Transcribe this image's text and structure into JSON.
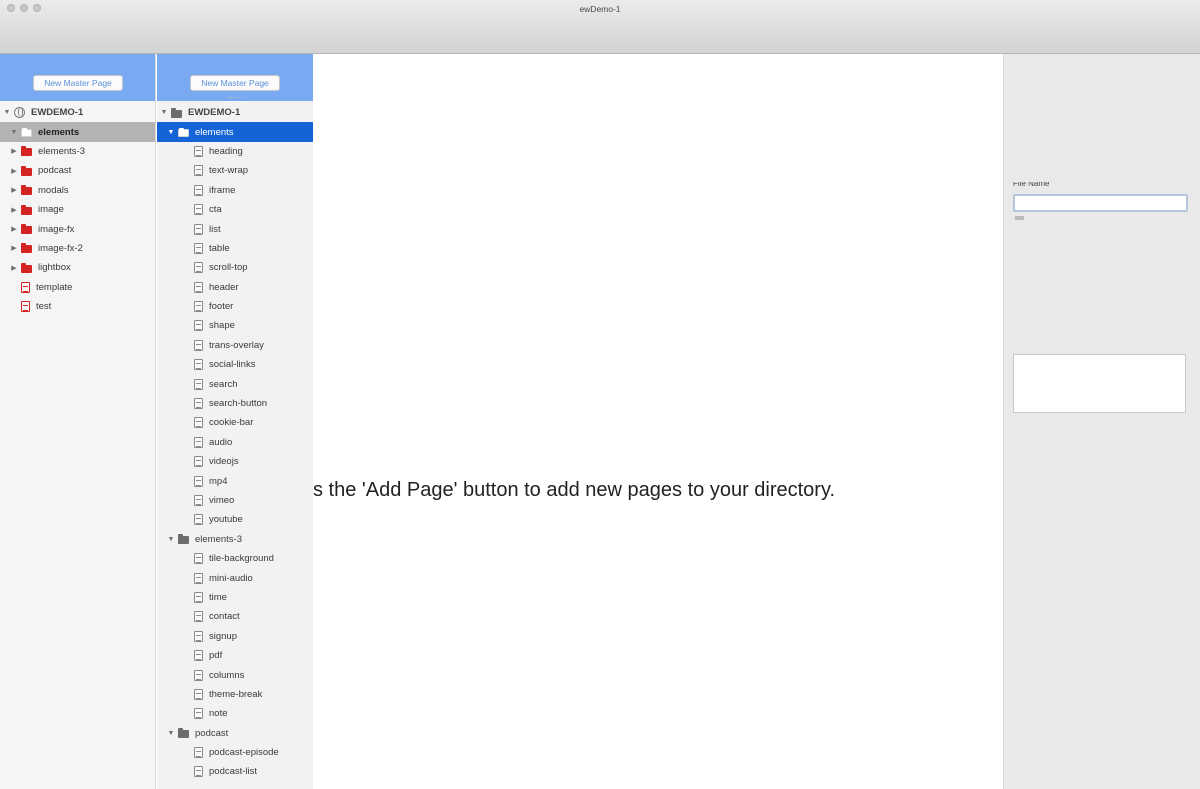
{
  "window": {
    "title": "ewDemo-1"
  },
  "left_panel": {
    "button_label": "New Master Page",
    "root_label": "EWDEMO-1",
    "items": [
      {
        "label": "elements",
        "kind": "folder",
        "state": "selected",
        "icon": "folder-open-icon"
      },
      {
        "label": "elements-3",
        "kind": "folder",
        "icon": "folder-icon"
      },
      {
        "label": "podcast",
        "kind": "folder",
        "icon": "folder-icon"
      },
      {
        "label": "modals",
        "kind": "folder",
        "icon": "folder-icon"
      },
      {
        "label": "image",
        "kind": "folder",
        "icon": "folder-icon"
      },
      {
        "label": "image-fx",
        "kind": "folder",
        "icon": "folder-icon"
      },
      {
        "label": "image-fx-2",
        "kind": "folder",
        "icon": "folder-icon"
      },
      {
        "label": "lightbox",
        "kind": "folder",
        "icon": "folder-icon"
      },
      {
        "label": "template",
        "kind": "page",
        "icon": "page-icon"
      },
      {
        "label": "test",
        "kind": "page",
        "icon": "page-icon"
      }
    ]
  },
  "mid_panel": {
    "button_label": "New Master Page",
    "root_label": "EWDEMO-1",
    "groups": [
      {
        "label": "elements",
        "state": "selected",
        "pages": [
          "heading",
          "text-wrap",
          "iframe",
          "cta",
          "list",
          "table",
          "scroll-top",
          "header",
          "footer",
          "shape",
          "trans-overlay",
          "social-links",
          "search",
          "search-button",
          "cookie-bar",
          "audio",
          "videojs",
          "mp4",
          "vimeo",
          "youtube"
        ]
      },
      {
        "label": "elements-3",
        "pages": [
          "tile-background",
          "mini-audio",
          "time",
          "contact",
          "signup",
          "pdf",
          "columns",
          "theme-break",
          "note"
        ]
      },
      {
        "label": "podcast",
        "pages": [
          "podcast-episode",
          "podcast-list"
        ]
      }
    ]
  },
  "main": {
    "hint": "s the 'Add Page' button to add new pages to your directory."
  },
  "inspector": {
    "file_name_label": "File Name",
    "file_name_value": ""
  },
  "colors": {
    "panel_header": "#79a9f1",
    "selection_blue": "#1464d8",
    "selection_grey": "#b3b3b3",
    "folder_red": "#d32323"
  }
}
